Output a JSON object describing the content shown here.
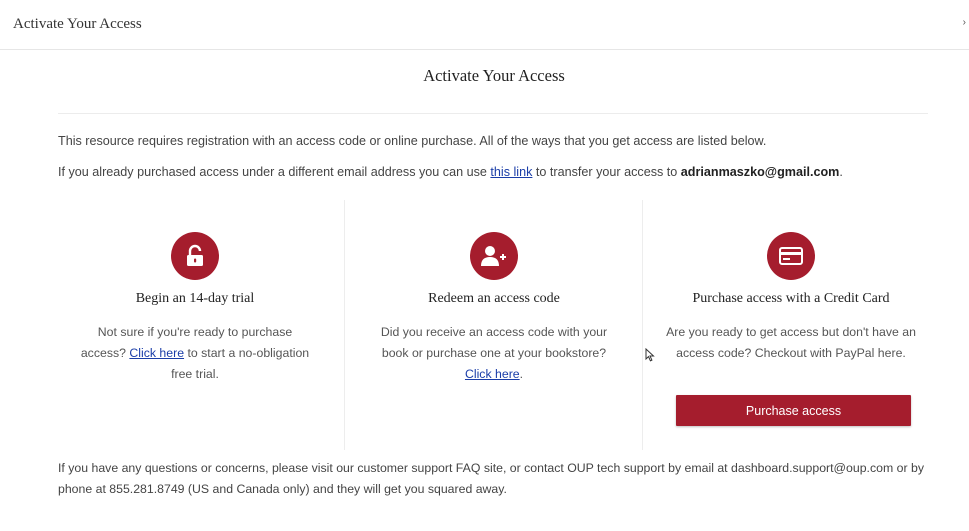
{
  "window": {
    "title": "Activate Your Access",
    "close_glyph": "›"
  },
  "page": {
    "title": "Activate Your Access",
    "intro_line1": "This resource requires registration with an access code or online purchase. All of the ways that you get access are listed below.",
    "intro_line2_before": "If you already purchased access under a different email address you can use ",
    "intro_line2_link": "this link",
    "intro_line2_middle": " to transfer your access to ",
    "intro_line2_email": "adrianmaszko@gmail.com",
    "intro_line2_end": "."
  },
  "cards": {
    "trial": {
      "icon": "unlock-icon",
      "title": "Begin an 14-day trial",
      "desc_before": "Not sure if you're ready to purchase access? ",
      "desc_link": "Click here",
      "desc_after": " to start a no-obligation free trial."
    },
    "redeem": {
      "icon": "add-user-icon",
      "title": "Redeem an access code",
      "desc_before": "Did you receive an access code with your book or purchase one at your bookstore? ",
      "desc_link": "Click here",
      "desc_after": "."
    },
    "purchase": {
      "icon": "credit-card-icon",
      "title": "Purchase access with a Credit Card",
      "desc": "Are you ready to get access but don't have an access code? Checkout with PayPal here.",
      "button_label": "Purchase access"
    }
  },
  "footer": {
    "text": "If you have any questions or concerns, please visit our customer support FAQ site, or contact OUP tech support by email at dashboard.support@oup.com or by phone at 855.281.8749 (US and Canada only) and they will get you squared away."
  },
  "colors": {
    "accent": "#a51d2d",
    "link": "#1a3da8"
  }
}
